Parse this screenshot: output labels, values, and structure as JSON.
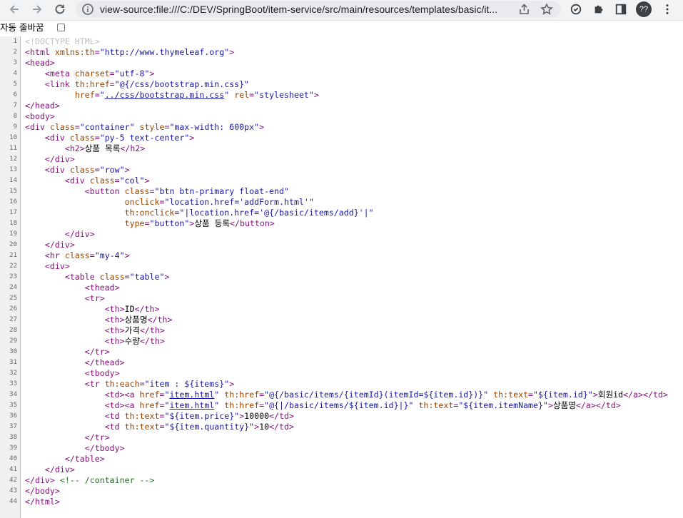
{
  "browser": {
    "url": "view-source:file:///C:/DEV/SpringBoot/item-service/src/main/resources/templates/basic/it...",
    "avatar_text": "??",
    "icons": [
      "back-arrow-icon",
      "forward-arrow-icon",
      "reload-icon",
      "info-icon",
      "share-icon",
      "star-icon",
      "sync-icon",
      "extensions-puzzle-icon",
      "side-panel-icon",
      "kebab-menu-icon"
    ]
  },
  "wrap": {
    "label": "자동 줄바꿈",
    "checked": false
  },
  "source_lines": [
    {
      "n": "1"
    },
    {
      "n": "2"
    },
    {
      "n": "3"
    },
    {
      "n": "4"
    },
    {
      "n": "5"
    },
    {
      "n": "6"
    },
    {
      "n": "7"
    },
    {
      "n": "8"
    },
    {
      "n": "9"
    },
    {
      "n": "10"
    },
    {
      "n": "11"
    },
    {
      "n": "12"
    },
    {
      "n": "13"
    },
    {
      "n": "14"
    },
    {
      "n": "15"
    },
    {
      "n": "16"
    },
    {
      "n": "17"
    },
    {
      "n": "18"
    },
    {
      "n": "19"
    },
    {
      "n": "20"
    },
    {
      "n": "21"
    },
    {
      "n": "22"
    },
    {
      "n": "23"
    },
    {
      "n": "24"
    },
    {
      "n": "25"
    },
    {
      "n": "26"
    },
    {
      "n": "27"
    },
    {
      "n": "28"
    },
    {
      "n": "29"
    },
    {
      "n": "30"
    },
    {
      "n": "31"
    },
    {
      "n": "32"
    },
    {
      "n": "33"
    },
    {
      "n": "34"
    },
    {
      "n": "35"
    },
    {
      "n": "36"
    },
    {
      "n": "37"
    },
    {
      "n": "38"
    },
    {
      "n": "39"
    },
    {
      "n": "40"
    },
    {
      "n": "41"
    },
    {
      "n": "42"
    },
    {
      "n": "43"
    },
    {
      "n": "44"
    }
  ],
  "code": {
    "l1": {
      "doctype": "<!DOCTYPE HTML>"
    },
    "l2": {
      "open": "<html",
      "a1": " xmlns:th",
      "eq": "=",
      "v1": "\"http://www.thymeleaf.org\"",
      "close": ">"
    },
    "l3": {
      "t": "<head>"
    },
    "l4": {
      "indent": "    ",
      "open": "<meta",
      "a1": " charset",
      "eq": "=",
      "v1": "\"utf-8\"",
      "close": ">"
    },
    "l5": {
      "indent": "    ",
      "open": "<link",
      "a1": " th:href",
      "eq": "=",
      "v1": "\"@{/css/bootstrap.min.css}\""
    },
    "l6": {
      "indent": "          ",
      "a1": "href",
      "eq": "=",
      "q1": "\"",
      "link": "../css/bootstrap.min.css",
      "q2": "\"",
      "a2": " rel",
      "eq2": "=",
      "v2": "\"stylesheet\"",
      "close": ">"
    },
    "l7": {
      "t": "</head>"
    },
    "l8": {
      "t": "<body>"
    },
    "l9": {
      "open": "<div",
      "a1": " class",
      "eq": "=",
      "v1": "\"container\"",
      "a2": " style",
      "eq2": "=",
      "v2": "\"max-width: 600px\"",
      "close": ">"
    },
    "l10": {
      "indent": "    ",
      "open": "<div",
      "a1": " class",
      "eq": "=",
      "v1": "\"py-5 text-center\"",
      "close": ">"
    },
    "l11": {
      "indent": "        ",
      "open": "<h2>",
      "text": "상품 목록",
      "close": "</h2>"
    },
    "l12": {
      "indent": "    ",
      "t": "</div>"
    },
    "l13": {
      "indent": "    ",
      "open": "<div",
      "a1": " class",
      "eq": "=",
      "v1": "\"row\"",
      "close": ">"
    },
    "l14": {
      "indent": "        ",
      "open": "<div",
      "a1": " class",
      "eq": "=",
      "v1": "\"col\"",
      "close": ">"
    },
    "l15": {
      "indent": "            ",
      "open": "<button",
      "a1": " class",
      "eq": "=",
      "v1": "\"btn btn-primary float-end\""
    },
    "l16": {
      "indent": "                    ",
      "a1": "onclick",
      "eq": "=",
      "v1": "\"location.href='addForm.html'\""
    },
    "l17": {
      "indent": "                    ",
      "a1": "th:onclick",
      "eq": "=",
      "v1": "\"|location.href='@{/basic/items/add}'|\""
    },
    "l18": {
      "indent": "                    ",
      "a1": "type",
      "eq": "=",
      "v1": "\"button\"",
      "close": ">",
      "text": "상품 등록",
      "end": "</button>"
    },
    "l19": {
      "indent": "        ",
      "t": "</div>"
    },
    "l20": {
      "indent": "    ",
      "t": "</div>"
    },
    "l21": {
      "indent": "    ",
      "open": "<hr",
      "a1": " class",
      "eq": "=",
      "v1": "\"my-4\"",
      "close": ">"
    },
    "l22": {
      "indent": "    ",
      "t": "<div>"
    },
    "l23": {
      "indent": "        ",
      "open": "<table",
      "a1": " class",
      "eq": "=",
      "v1": "\"table\"",
      "close": ">"
    },
    "l24": {
      "indent": "            ",
      "t": "<thead>"
    },
    "l25": {
      "indent": "            ",
      "t": "<tr>"
    },
    "l26": {
      "indent": "                ",
      "open": "<th>",
      "text": "ID",
      "close": "</th>"
    },
    "l27": {
      "indent": "                ",
      "open": "<th>",
      "text": "상품명",
      "close": "</th>"
    },
    "l28": {
      "indent": "                ",
      "open": "<th>",
      "text": "가격",
      "close": "</th>"
    },
    "l29": {
      "indent": "                ",
      "open": "<th>",
      "text": "수량",
      "close": "</th>"
    },
    "l30": {
      "indent": "            ",
      "t": "</tr>"
    },
    "l31": {
      "indent": "            ",
      "t": "</thead>"
    },
    "l32": {
      "indent": "            ",
      "t": "<tbody>"
    },
    "l33": {
      "indent": "            ",
      "open": "<tr",
      "a1": " th:each",
      "eq": "=",
      "v1": "\"item : ${items}\"",
      "close": ">"
    },
    "l34": {
      "indent": "                ",
      "td": "<td>",
      "aopen": "<a",
      "a1": " href",
      "eq": "=",
      "q1": "\"",
      "link": "item.html",
      "q2": "\"",
      "a2": " th:href",
      "eq2": "=",
      "v2": "\"@{/basic/items/{itemId}(itemId=${item.id})}\"",
      "a3": " th:text",
      "eq3": "=",
      "v3": "\"${item.id}\"",
      "close": ">",
      "text": "회원id",
      "aclose": "</a>",
      "tdclose": "</td>"
    },
    "l35": {
      "indent": "                ",
      "td": "<td>",
      "aopen": "<a",
      "a1": " href",
      "eq": "=",
      "q1": "\"",
      "link": "item.html",
      "q2": "\"",
      "a2": " th:href",
      "eq2": "=",
      "v2": "\"@{|/basic/items/${item.id}|}\"",
      "a3": " th:text",
      "eq3": "=",
      "v3": "\"${item.itemName}\"",
      "close": ">",
      "text": "상품명",
      "aclose": "</a>",
      "tdclose": "</td>"
    },
    "l36": {
      "indent": "                ",
      "open": "<td",
      "a1": " th:text",
      "eq": "=",
      "v1": "\"${item.price}\"",
      "close": ">",
      "text": "10000",
      "end": "</td>"
    },
    "l37": {
      "indent": "                ",
      "open": "<td",
      "a1": " th:text",
      "eq": "=",
      "v1": "\"${item.quantity}\"",
      "close": ">",
      "text": "10",
      "end": "</td>"
    },
    "l38": {
      "indent": "            ",
      "t": "</tr>"
    },
    "l39": {
      "indent": "            ",
      "t": "</tbody>"
    },
    "l40": {
      "indent": "        ",
      "t": "</table>"
    },
    "l41": {
      "indent": "    ",
      "t": "</div>"
    },
    "l42": {
      "t": "</div>",
      "sp": " ",
      "comment": "<!-- /container -->"
    },
    "l43": {
      "t": "</body>"
    },
    "l44": {
      "t": "</html>"
    }
  }
}
